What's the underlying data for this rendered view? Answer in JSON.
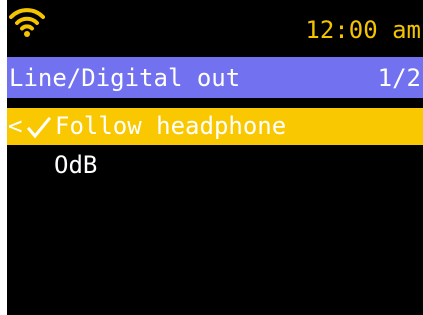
{
  "status": {
    "wifi_icon": "wifi-icon",
    "time": "12:00 am"
  },
  "header": {
    "title": "Line/Digital out",
    "page": "1/2"
  },
  "menu": {
    "items": [
      {
        "label": "Follow headphone",
        "selected": true,
        "checked": true,
        "back_marker": "<"
      },
      {
        "label": "OdB",
        "selected": false,
        "checked": false
      }
    ]
  },
  "colors": {
    "background": "#000000",
    "accent": "#f5c400",
    "title_bar": "#7272f0",
    "selection": "#fac800",
    "text": "#ffffff"
  }
}
